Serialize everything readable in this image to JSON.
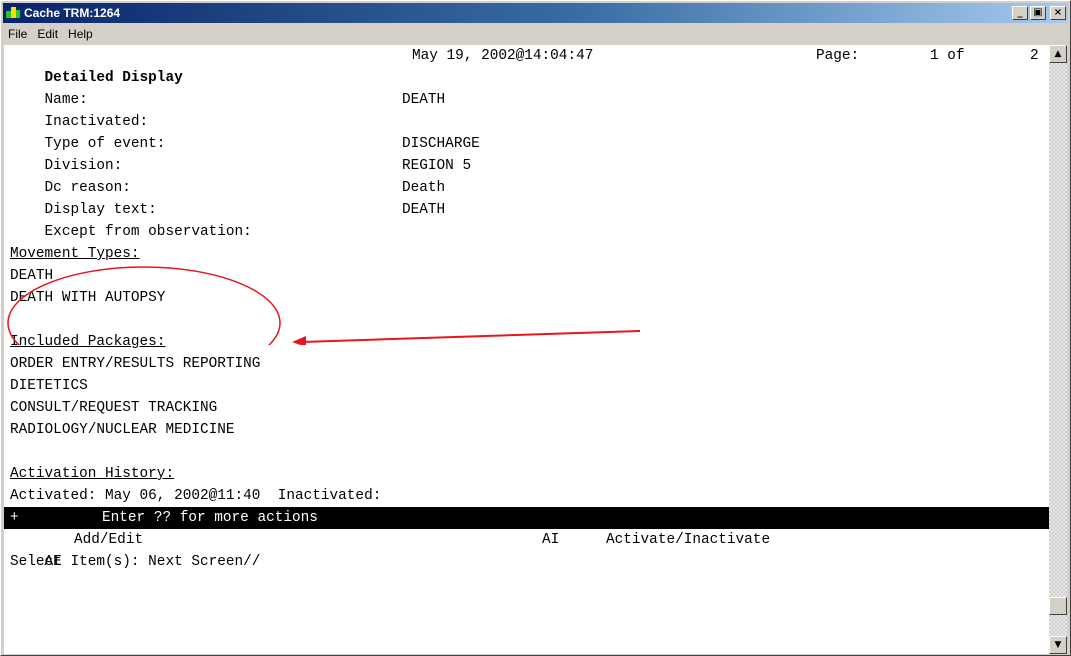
{
  "window": {
    "title": "Cache TRM:1264",
    "minimize_glyph": "_",
    "maximize_glyph": "▣",
    "close_glyph": "×"
  },
  "menu": [
    "File",
    "Edit",
    "Help"
  ],
  "header": {
    "title": "Detailed Display",
    "date": "May 19, 2002@14:04:47",
    "page_label": "Page:",
    "page_of": "1 of",
    "page_total": "2"
  },
  "fields": [
    {
      "label": "Name:",
      "value": "DEATH"
    },
    {
      "label": "Inactivated:",
      "value": ""
    },
    {
      "label": "Type of event:",
      "value": "DISCHARGE"
    },
    {
      "label": "Division:",
      "value": "REGION 5"
    },
    {
      "label": "Dc reason:",
      "value": "Death"
    },
    {
      "label": "Display text:",
      "value": "DEATH"
    },
    {
      "label": "Except from observation:",
      "value": ""
    }
  ],
  "movement_types": {
    "heading": "Movement Types:",
    "items": [
      "DEATH",
      "DEATH WITH AUTOPSY"
    ]
  },
  "included_packages": {
    "heading": "Included Packages:",
    "items": [
      "ORDER ENTRY/RESULTS REPORTING",
      "DIETETICS",
      "CONSULT/REQUEST TRACKING",
      "RADIOLOGY/NUCLEAR MEDICINE"
    ]
  },
  "activation_history": {
    "heading": "Activation History:",
    "line": "Activated: May 06, 2002@11:40  Inactivated:"
  },
  "actions": {
    "plus": "+",
    "message": "Enter ?? for more actions",
    "add_edit_code": "AE",
    "add_edit_label": "Add/Edit",
    "activate_code": "AI",
    "activate_label": "Activate/Inactivate",
    "prompt": "Select Item(s): Next Screen//"
  },
  "scrollbar": {
    "up_glyph": "▲",
    "down_glyph": "▼"
  },
  "colors": {
    "annotation": "#e8141e",
    "titlebar_start": "#0a246a",
    "actions_bar_bg": "#000000"
  }
}
